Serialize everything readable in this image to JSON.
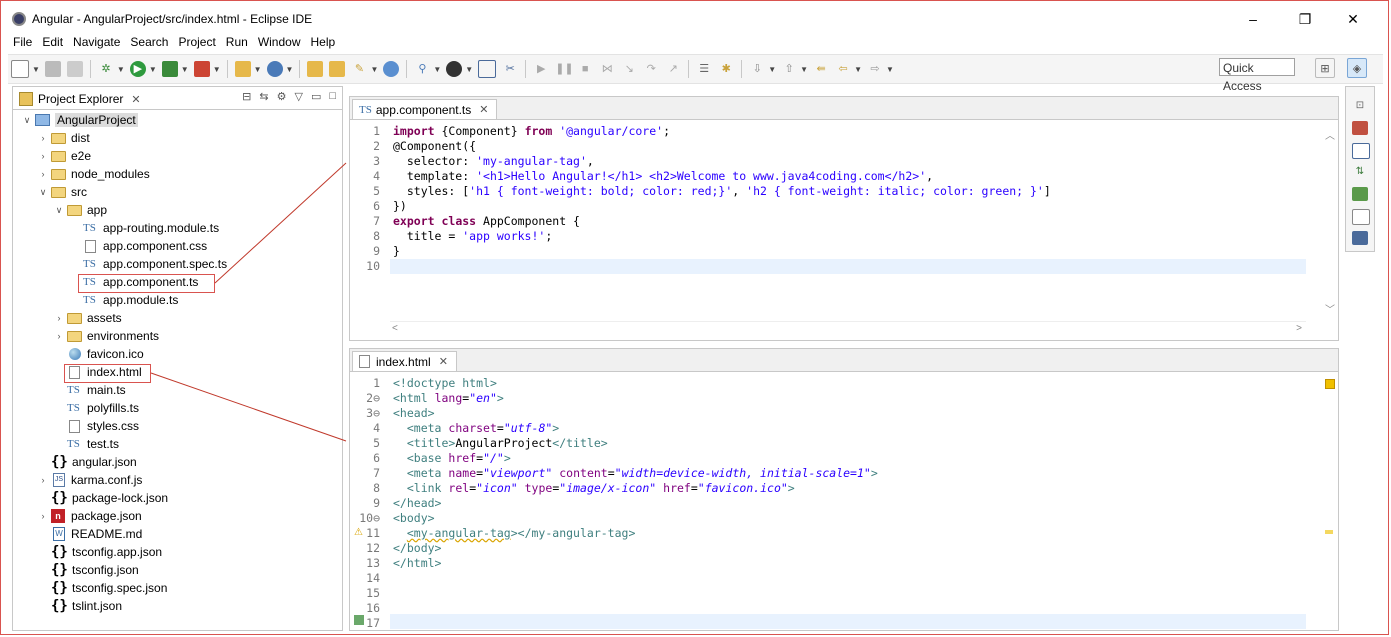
{
  "window": {
    "title": "Angular - AngularProject/src/index.html - Eclipse IDE",
    "controls": [
      "–",
      "❐",
      "✕"
    ]
  },
  "menu": [
    "File",
    "Edit",
    "Navigate",
    "Search",
    "Project",
    "Run",
    "Window",
    "Help"
  ],
  "toolbar": {
    "quick_access": "Quick Access"
  },
  "explorer": {
    "tab_label": "Project Explorer",
    "tree": [
      {
        "label": "AngularProject",
        "icon": "project-icon",
        "twisty": "open",
        "selected": true
      },
      {
        "label": "dist",
        "icon": "folder-icon",
        "twisty": "closed"
      },
      {
        "label": "e2e",
        "icon": "folder-icon",
        "twisty": "closed"
      },
      {
        "label": "node_modules",
        "icon": "folder-icon",
        "twisty": "closed"
      },
      {
        "label": "src",
        "icon": "folder-icon",
        "twisty": "open"
      },
      {
        "label": "app",
        "icon": "folder-icon",
        "twisty": "open"
      },
      {
        "label": "app-routing.module.ts",
        "icon": "ts-icon",
        "twisty": ""
      },
      {
        "label": "app.component.css",
        "icon": "file-icon",
        "twisty": ""
      },
      {
        "label": "app.component.spec.ts",
        "icon": "ts-icon",
        "twisty": ""
      },
      {
        "label": "app.component.ts",
        "icon": "ts-icon",
        "twisty": "",
        "highlight": true
      },
      {
        "label": "app.module.ts",
        "icon": "ts-icon",
        "twisty": ""
      },
      {
        "label": "assets",
        "icon": "folder-icon",
        "twisty": "closed"
      },
      {
        "label": "environments",
        "icon": "folder-icon",
        "twisty": "closed"
      },
      {
        "label": "favicon.ico",
        "icon": "globe-icon",
        "twisty": ""
      },
      {
        "label": "index.html",
        "icon": "file-icon",
        "twisty": "",
        "highlight": true
      },
      {
        "label": "main.ts",
        "icon": "ts-icon",
        "twisty": ""
      },
      {
        "label": "polyfills.ts",
        "icon": "ts-icon",
        "twisty": ""
      },
      {
        "label": "styles.css",
        "icon": "file-icon",
        "twisty": ""
      },
      {
        "label": "test.ts",
        "icon": "ts-icon",
        "twisty": ""
      },
      {
        "label": "angular.json",
        "icon": "json-icon",
        "twisty": ""
      },
      {
        "label": "karma.conf.js",
        "icon": "js-icon",
        "twisty": "closed"
      },
      {
        "label": "package-lock.json",
        "icon": "json-icon",
        "twisty": ""
      },
      {
        "label": "package.json",
        "icon": "npm-icon",
        "twisty": "closed"
      },
      {
        "label": "README.md",
        "icon": "md-icon",
        "twisty": ""
      },
      {
        "label": "tsconfig.app.json",
        "icon": "json-icon",
        "twisty": ""
      },
      {
        "label": "tsconfig.json",
        "icon": "json-icon",
        "twisty": ""
      },
      {
        "label": "tsconfig.spec.json",
        "icon": "json-icon",
        "twisty": ""
      },
      {
        "label": "tslint.json",
        "icon": "json-icon",
        "twisty": ""
      }
    ]
  },
  "editor_ts": {
    "tab_label": "app.component.ts",
    "tab_prefix": "TS",
    "lines": [
      "import {Component} from '@angular/core';",
      "@Component({",
      "  selector: 'my-angular-tag',",
      "  template: '<h1>Hello Angular!</h1> <h2>Welcome to www.java4coding.com</h2>',",
      "  styles: ['h1 { font-weight: bold; color: red;}', 'h2 { font-weight: italic; color: green; }']",
      "})",
      "export class AppComponent {",
      "  title = 'app works!';",
      "}",
      ""
    ]
  },
  "editor_html": {
    "tab_label": "index.html",
    "line_numbers": [
      "1",
      "2⊖",
      "3⊖",
      "4",
      "5",
      "6",
      "7",
      "8",
      "9",
      "10⊖",
      "11",
      "12",
      "13",
      "14",
      "15",
      "16",
      "17"
    ],
    "lines": [
      "<!doctype html>",
      "<html lang=\"en\">",
      "<head>",
      "  <meta charset=\"utf-8\">",
      "  <title>AngularProject</title>",
      "  <base href=\"/\">",
      "  <meta name=\"viewport\" content=\"width=device-width, initial-scale=1\">",
      "  <link rel=\"icon\" type=\"image/x-icon\" href=\"favicon.ico\">",
      "</head>",
      "<body>",
      "  <my-angular-tag></my-angular-tag>",
      "</body>",
      "</html>",
      "",
      "",
      "",
      ""
    ]
  }
}
